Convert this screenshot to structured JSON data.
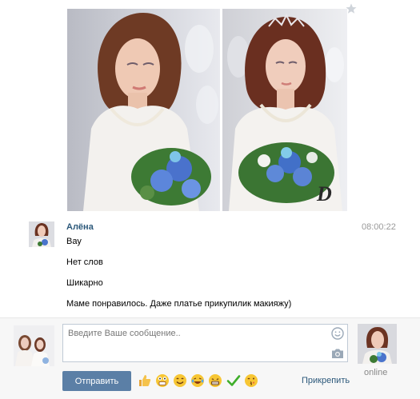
{
  "message": {
    "author": "Алёна",
    "time": "08:00:22",
    "lines": [
      "Вау",
      "Нет слов",
      "Шикарно",
      "Маме понравилось. Даже платье прикупилик макияжу)"
    ]
  },
  "composer": {
    "placeholder": "Введите Ваше сообщение..",
    "send_label": "Отправить",
    "attach_label": "Прикрепить",
    "status": "online",
    "emojis": [
      "thumbs-up",
      "shocked",
      "smile",
      "laugh-tears",
      "grimace",
      "check-mark",
      "wink-kiss"
    ]
  },
  "photo_watermark": "D",
  "colors": {
    "link": "#2b587a",
    "send_button": "#5b7fa6",
    "input_border": "#c0cad5",
    "bar_bg": "#f7f7f7",
    "time": "#999999"
  }
}
